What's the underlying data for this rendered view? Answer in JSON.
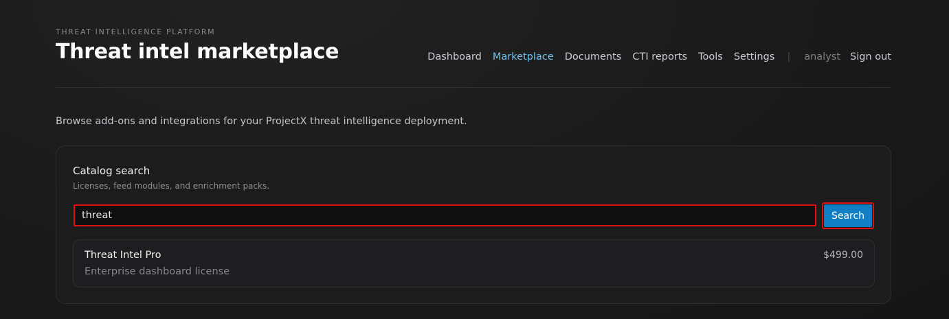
{
  "header": {
    "eyebrow": "THREAT INTELLIGENCE PLATFORM",
    "title": "Threat intel marketplace"
  },
  "nav": {
    "items": [
      {
        "label": "Dashboard",
        "active": false
      },
      {
        "label": "Marketplace",
        "active": true
      },
      {
        "label": "Documents",
        "active": false
      },
      {
        "label": "CTI reports",
        "active": false
      },
      {
        "label": "Tools",
        "active": false
      },
      {
        "label": "Settings",
        "active": false
      }
    ],
    "separator": "|",
    "username": "analyst",
    "signout_label": "Sign out"
  },
  "intro": "Browse add-ons and integrations for your ProjectX threat intelligence deployment.",
  "catalog": {
    "title": "Catalog search",
    "subtitle": "Licenses, feed modules, and enrichment packs.",
    "search_value": "threat",
    "search_button_label": "Search",
    "results": [
      {
        "name": "Threat Intel Pro",
        "description": "Enterprise dashboard license",
        "price": "$499.00"
      }
    ]
  },
  "colors": {
    "accent": "#0f7ec2",
    "nav_active": "#6ec1ef",
    "highlight_border": "#e01010"
  }
}
